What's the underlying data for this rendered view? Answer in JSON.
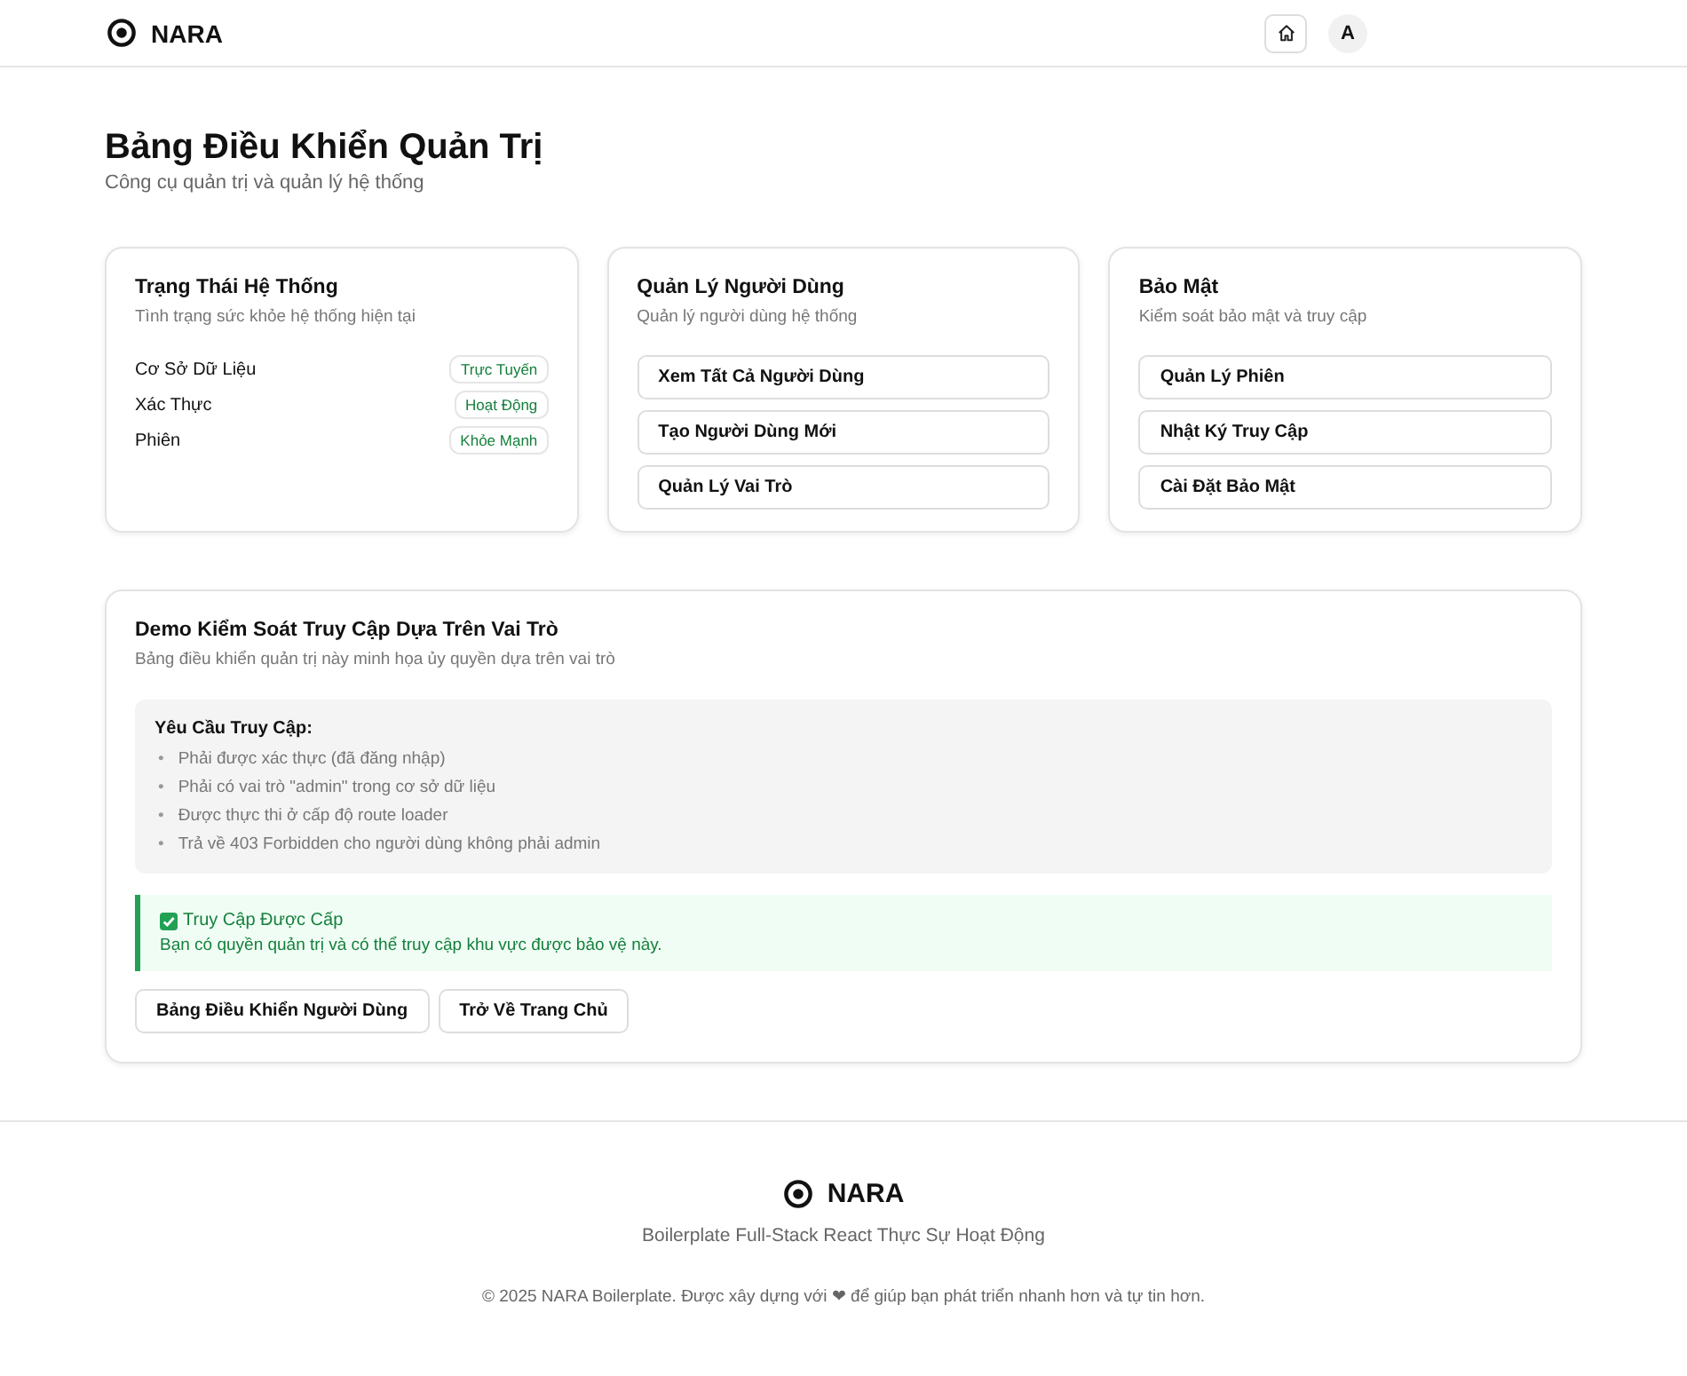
{
  "header": {
    "brand": "NARA",
    "avatar": "A"
  },
  "page": {
    "title": "Bảng Điều Khiển Quản Trị",
    "subtitle": "Công cụ quản trị và quản lý hệ thống"
  },
  "cards": [
    {
      "kind": "status",
      "title": "Trạng Thái Hệ Thống",
      "subtitle": "Tình trạng sức khỏe hệ thống hiện tại",
      "rows": [
        {
          "label": "Cơ Sở Dữ Liệu",
          "badge": "Trực Tuyến"
        },
        {
          "label": "Xác Thực",
          "badge": "Hoạt Động"
        },
        {
          "label": "Phiên",
          "badge": "Khỏe Mạnh"
        }
      ]
    },
    {
      "kind": "actions",
      "title": "Quản Lý Người Dùng",
      "subtitle": "Quản lý người dùng hệ thống",
      "actions": [
        "Xem Tất Cả Người Dùng",
        "Tạo Người Dùng Mới",
        "Quản Lý Vai Trò"
      ]
    },
    {
      "kind": "actions",
      "title": "Bảo Mật",
      "subtitle": "Kiểm soát bảo mật và truy cập",
      "actions": [
        "Quản Lý Phiên",
        "Nhật Ký Truy Cập",
        "Cài Đặt Bảo Mật"
      ]
    }
  ],
  "demo": {
    "title": "Demo Kiểm Soát Truy Cập Dựa Trên Vai Trò",
    "subtitle": "Bảng điều khiển quản trị này minh họa ủy quyền dựa trên vai trò",
    "requirements": {
      "title": "Yêu Cầu Truy Cập:",
      "marker": "•",
      "items": [
        "Phải được xác thực (đã đăng nhập)",
        "Phải có vai trò \"admin\" trong cơ sở dữ liệu",
        "Được thực thi ở cấp độ route loader",
        "Trả về 403 Forbidden cho người dùng không phải admin"
      ]
    },
    "alert": {
      "title": "Truy Cập Được Cấp",
      "message": "Bạn có quyền quản trị và có thể truy cập khu vực được bảo vệ này."
    },
    "buttons": [
      "Bảng Điều Khiển Người Dùng",
      "Trở Về Trang Chủ"
    ]
  },
  "footer": {
    "brand": "NARA",
    "tagline": "Boilerplate Full-Stack React Thực Sự Hoạt Động",
    "copyright": "© 2025 NARA Boilerplate. Được xây dựng với ❤ để giúp bạn phát triển nhanh hơn và tự tin hơn."
  }
}
